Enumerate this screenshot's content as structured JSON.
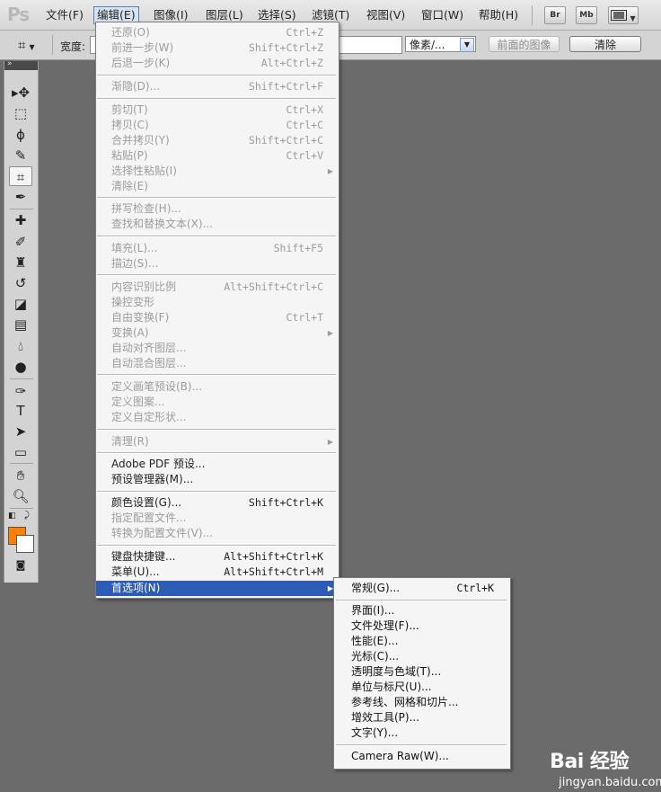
{
  "app": {
    "logo": "Ps"
  },
  "menubar": {
    "items": [
      "文件(F)",
      "编辑(E)",
      "图像(I)",
      "图层(L)",
      "选择(S)",
      "滤镜(T)",
      "视图(V)",
      "窗口(W)",
      "帮助(H)"
    ],
    "active": "编辑(E)",
    "buttons": {
      "bridge": "Br",
      "minibridge": "Mb"
    }
  },
  "options": {
    "width_label": "宽度:",
    "unit_select": "像素/...",
    "front_image_button": "前面的图像",
    "clear_button": "清除"
  },
  "edit_menu": {
    "items": [
      {
        "label": "还原(O)",
        "shortcut": "Ctrl+Z"
      },
      {
        "label": "前进一步(W)",
        "shortcut": "Shift+Ctrl+Z"
      },
      {
        "label": "后退一步(K)",
        "shortcut": "Alt+Ctrl+Z"
      },
      {
        "label": "渐隐(D)...",
        "shortcut": "Shift+Ctrl+F"
      },
      {
        "label": "剪切(T)",
        "shortcut": "Ctrl+X"
      },
      {
        "label": "拷贝(C)",
        "shortcut": "Ctrl+C"
      },
      {
        "label": "合并拷贝(Y)",
        "shortcut": "Shift+Ctrl+C"
      },
      {
        "label": "粘贴(P)",
        "shortcut": "Ctrl+V"
      },
      {
        "label": "选择性粘贴(I)",
        "shortcut": ""
      },
      {
        "label": "清除(E)",
        "shortcut": ""
      },
      {
        "label": "拼写检查(H)...",
        "shortcut": ""
      },
      {
        "label": "查找和替换文本(X)...",
        "shortcut": ""
      },
      {
        "label": "填充(L)...",
        "shortcut": "Shift+F5"
      },
      {
        "label": "描边(S)...",
        "shortcut": ""
      },
      {
        "label": "内容识别比例",
        "shortcut": "Alt+Shift+Ctrl+C"
      },
      {
        "label": "操控变形",
        "shortcut": ""
      },
      {
        "label": "自由变换(F)",
        "shortcut": "Ctrl+T"
      },
      {
        "label": "变换(A)",
        "shortcut": ""
      },
      {
        "label": "自动对齐图层...",
        "shortcut": ""
      },
      {
        "label": "自动混合图层...",
        "shortcut": ""
      },
      {
        "label": "定义画笔预设(B)...",
        "shortcut": ""
      },
      {
        "label": "定义图案...",
        "shortcut": ""
      },
      {
        "label": "定义自定形状...",
        "shortcut": ""
      },
      {
        "label": "清理(R)",
        "shortcut": ""
      },
      {
        "label": "Adobe PDF 预设...",
        "shortcut": ""
      },
      {
        "label": "预设管理器(M)...",
        "shortcut": ""
      },
      {
        "label": "颜色设置(G)...",
        "shortcut": "Shift+Ctrl+K"
      },
      {
        "label": "指定配置文件...",
        "shortcut": ""
      },
      {
        "label": "转换为配置文件(V)...",
        "shortcut": ""
      },
      {
        "label": "键盘快捷键...",
        "shortcut": "Alt+Shift+Ctrl+K"
      },
      {
        "label": "菜单(U)...",
        "shortcut": "Alt+Shift+Ctrl+M"
      },
      {
        "label": "首选项(N)",
        "shortcut": ""
      }
    ]
  },
  "preferences_submenu": {
    "items": [
      {
        "label": "常规(G)...",
        "shortcut": "Ctrl+K"
      },
      {
        "label": "界面(I)...",
        "shortcut": ""
      },
      {
        "label": "文件处理(F)...",
        "shortcut": ""
      },
      {
        "label": "性能(E)...",
        "shortcut": ""
      },
      {
        "label": "光标(C)...",
        "shortcut": ""
      },
      {
        "label": "透明度与色域(T)...",
        "shortcut": ""
      },
      {
        "label": "单位与标尺(U)...",
        "shortcut": ""
      },
      {
        "label": "参考线、网格和切片...",
        "shortcut": ""
      },
      {
        "label": "增效工具(P)...",
        "shortcut": ""
      },
      {
        "label": "文字(Y)...",
        "shortcut": ""
      },
      {
        "label": "Camera Raw(W)...",
        "shortcut": ""
      }
    ]
  },
  "colors": {
    "foreground": "#ff8000",
    "background": "#ffffff",
    "highlight": "#2d5bb8"
  },
  "watermark": {
    "brand": "Bai 经验",
    "site": "jingyan.baidu.com"
  }
}
